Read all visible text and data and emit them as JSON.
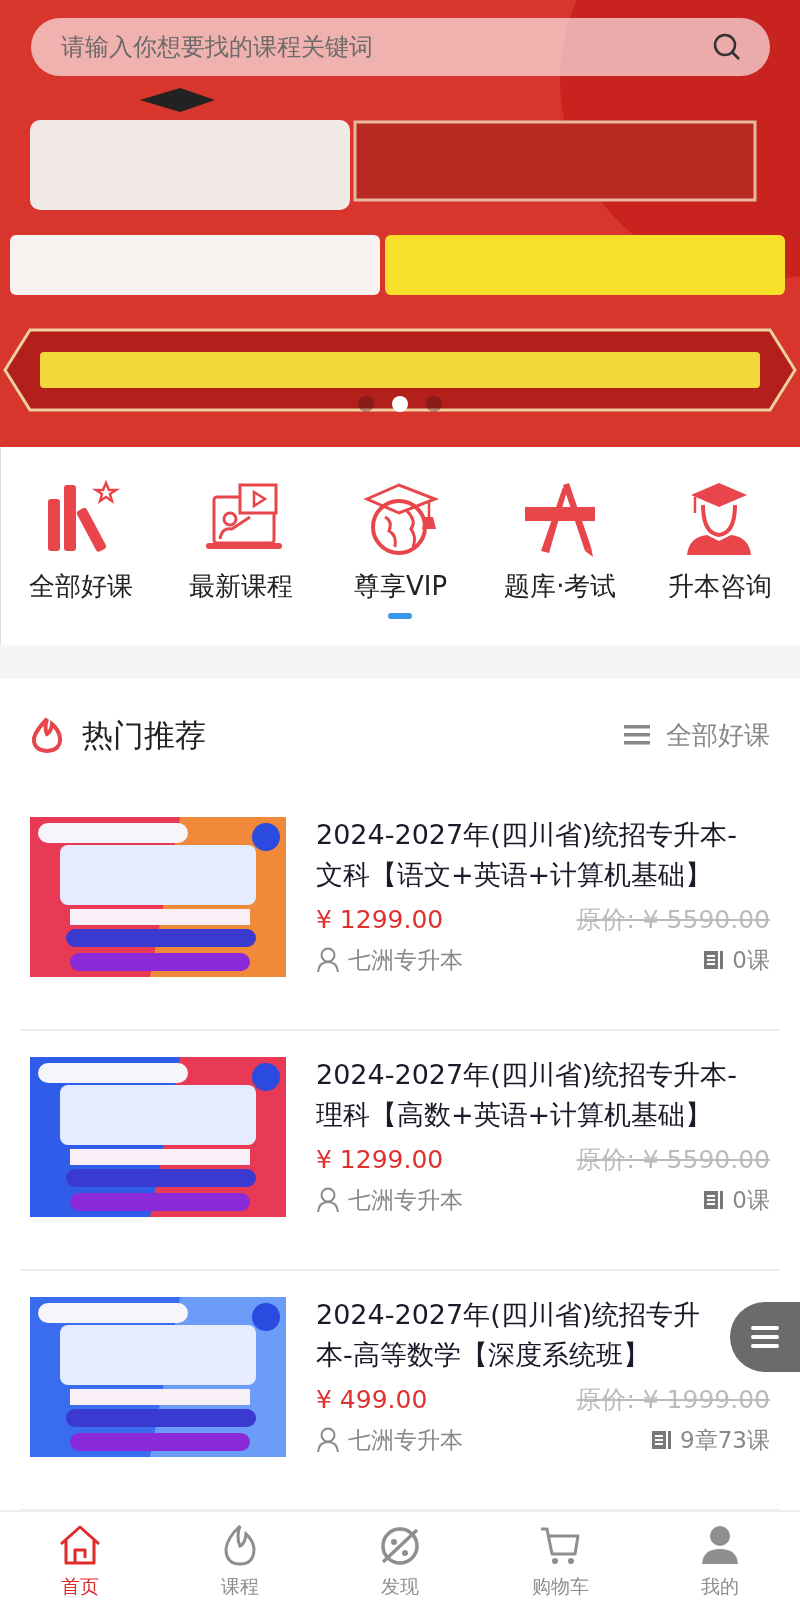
{
  "search": {
    "placeholder": "请输入你想要找的课程关键词"
  },
  "banner": {
    "kind": "picture",
    "dots": [
      {
        "selected": false
      },
      {
        "selected": true
      },
      {
        "selected": false
      }
    ]
  },
  "categories": [
    {
      "label": "全部好课",
      "kind": "books"
    },
    {
      "label": "最新课程",
      "kind": "lecture"
    },
    {
      "label": "尊享VIP",
      "kind": "globe"
    },
    {
      "label": "题库·考试",
      "kind": "tools"
    },
    {
      "label": "升本咨询",
      "kind": "graduate"
    }
  ],
  "section": {
    "title": "热门推荐",
    "more_label": "全部好课"
  },
  "courses": [
    {
      "title": "2024-2027年(四川省)统招专升本-文科【语文+英语+计算机基础】",
      "price": "¥ 1299.00",
      "original_price": "原价: ¥ 5590.00",
      "teacher": "七洲专升本",
      "lessons": "0课"
    },
    {
      "title": "2024-2027年(四川省)统招专升本-理科【高数+英语+计算机基础】",
      "price": "¥ 1299.00",
      "original_price": "原价: ¥ 5590.00",
      "teacher": "七洲专升本",
      "lessons": "0课"
    },
    {
      "title": "2024-2027年(四川省)统招专升本-高等数学【深度系统班】",
      "price": "¥ 499.00",
      "original_price": "原价: ¥ 1999.00",
      "teacher": "七洲专升本",
      "lessons": "9章73课"
    }
  ],
  "bottom_nav": [
    {
      "label": "首页",
      "kind": "home",
      "selected": true
    },
    {
      "label": "课程",
      "kind": "flame",
      "selected": false
    },
    {
      "label": "发现",
      "kind": "planet",
      "selected": false
    },
    {
      "label": "购物车",
      "kind": "cart",
      "selected": false
    },
    {
      "label": "我的",
      "kind": "user",
      "selected": false
    }
  ]
}
